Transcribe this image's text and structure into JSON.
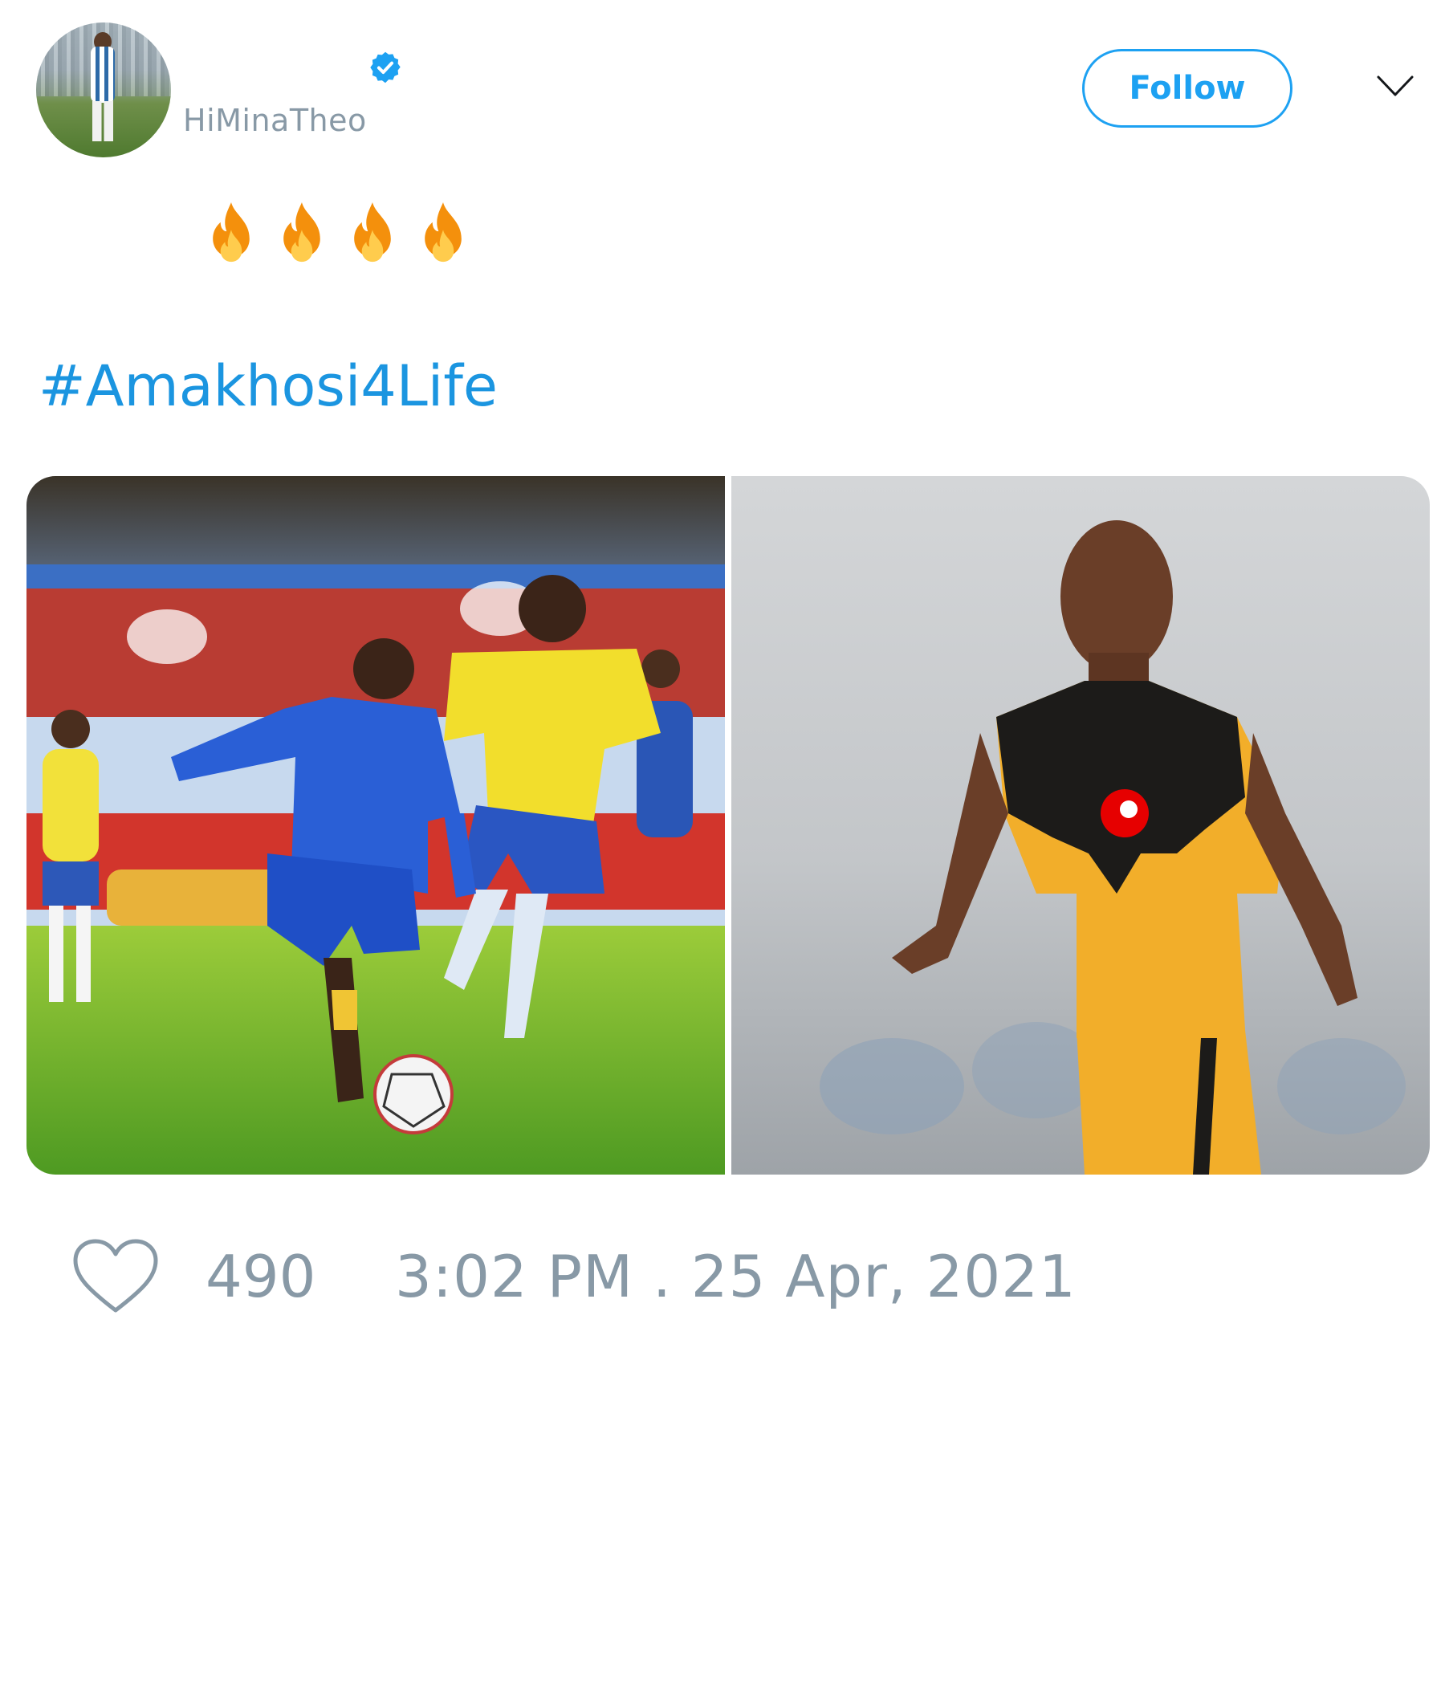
{
  "tweet": {
    "user": {
      "handle": "HiMinaTheo",
      "verified_icon": "verified-badge-icon",
      "avatar_icon": "profile-avatar"
    },
    "follow_label": "Follow",
    "menu_icon": "chevron-down-icon",
    "emoji_icons": [
      "fire-icon",
      "fire-icon",
      "fire-icon",
      "fire-icon"
    ],
    "hashtag": "#Amakhosi4Life",
    "photos": [
      {
        "icon": "match-action-photo"
      },
      {
        "icon": "player-portrait-photo"
      }
    ],
    "like_icon": "heart-icon",
    "like_count": "490",
    "timestamp": "3:02 PM . 25 Apr, 2021"
  },
  "colors": {
    "link": "#1b95e0",
    "follow": "#1da1f2",
    "muted": "#8899a6"
  }
}
